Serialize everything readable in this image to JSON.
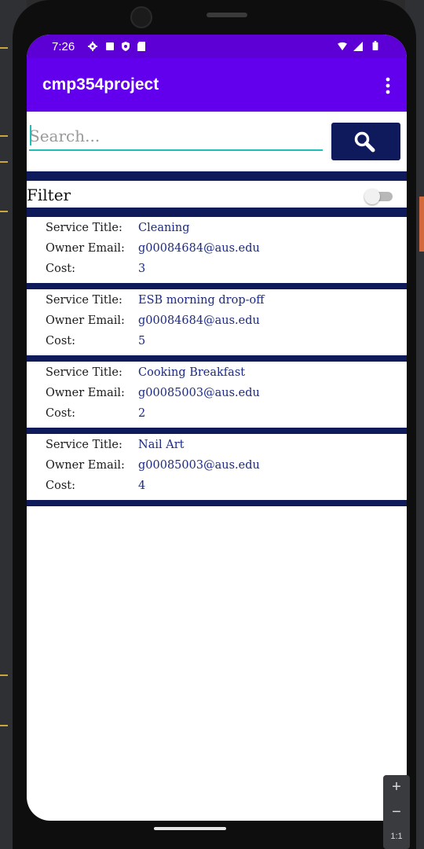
{
  "status_bar": {
    "time": "7:26",
    "icons": [
      "gear-icon",
      "square-icon",
      "shield-icon",
      "sd-card-icon",
      "wifi-icon",
      "signal-icon",
      "battery-icon"
    ]
  },
  "app_bar": {
    "title": "cmp354project",
    "menu_icon": "more-vert-icon"
  },
  "search": {
    "placeholder": "Search...",
    "value": "",
    "button_icon": "search-icon"
  },
  "filter": {
    "label": "Filter",
    "enabled": false
  },
  "labels": {
    "service_title": "Service Title:",
    "owner_email": "Owner Email:",
    "cost": "Cost:"
  },
  "services": [
    {
      "title": "Cleaning",
      "email": "g00084684@aus.edu",
      "cost": "3"
    },
    {
      "title": "ESB morning drop-off",
      "email": "g00084684@aus.edu",
      "cost": "5"
    },
    {
      "title": "Cooking Breakfast",
      "email": "g00085003@aus.edu",
      "cost": "2"
    },
    {
      "title": "Nail Art",
      "email": "g00085003@aus.edu",
      "cost": "4"
    }
  ],
  "emulator_zoom": {
    "zoom_in": "+",
    "zoom_out": "−",
    "ratio": "1:1"
  },
  "colors": {
    "status_bar": "#5d00d6",
    "app_bar": "#6200ee",
    "divider": "#0f1a5a",
    "value_text": "#1c2a82",
    "search_underline": "#1fbfb8"
  }
}
